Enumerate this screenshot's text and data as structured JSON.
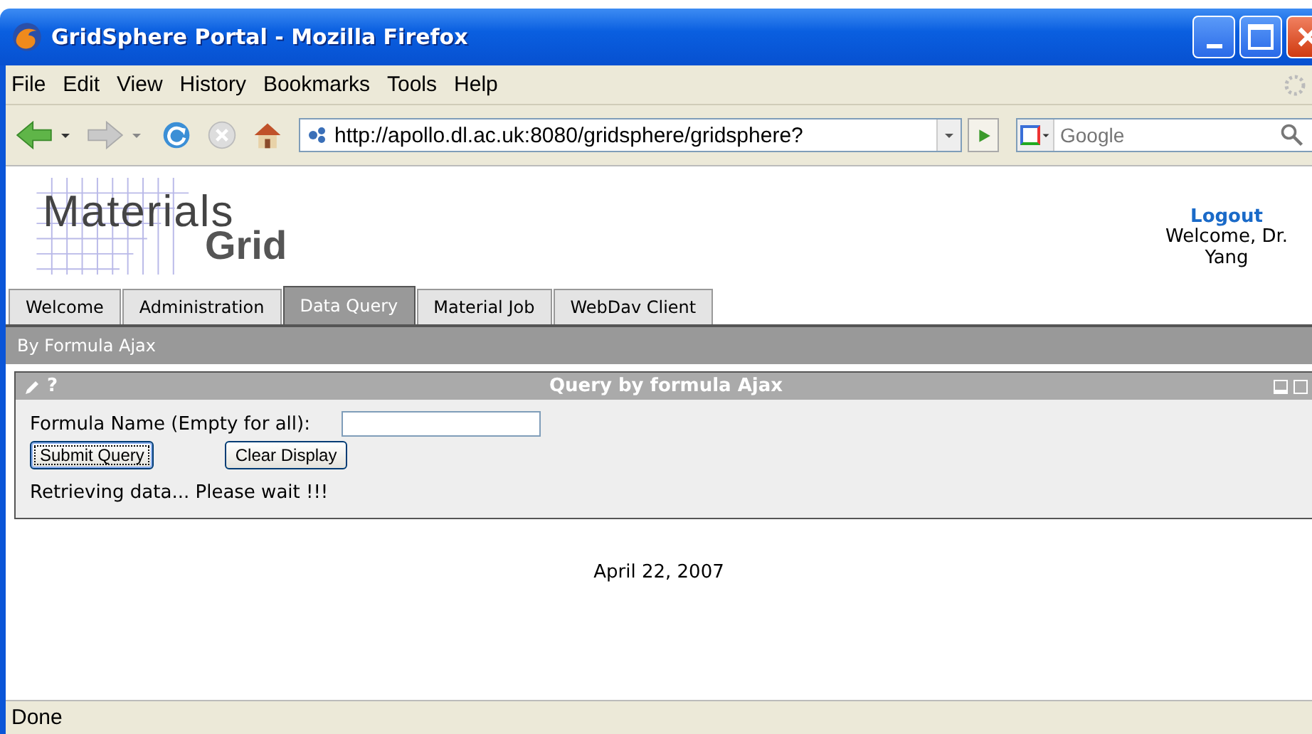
{
  "window": {
    "title": "GridSphere Portal - Mozilla Firefox"
  },
  "menu": [
    "File",
    "Edit",
    "View",
    "History",
    "Bookmarks",
    "Tools",
    "Help"
  ],
  "address_bar": {
    "value": "http://apollo.dl.ac.uk:8080/gridsphere/gridsphere?"
  },
  "search": {
    "placeholder": "Google"
  },
  "header": {
    "logo_top": "Materials",
    "logo_bottom": "Grid",
    "logout": "Logout",
    "welcome": "Welcome, Dr. Yang"
  },
  "tabs": [
    {
      "label": "Welcome",
      "selected": false
    },
    {
      "label": "Administration",
      "selected": false
    },
    {
      "label": "Data Query",
      "selected": true
    },
    {
      "label": "Material Job",
      "selected": false
    },
    {
      "label": "WebDav Client",
      "selected": false
    }
  ],
  "subnav": [
    "By Formula Ajax"
  ],
  "portlet": {
    "title": "Query by formula Ajax",
    "help": "?",
    "field_label": "Formula Name (Empty for all):",
    "buttons": [
      "Submit Query",
      "Clear Display"
    ],
    "message": "Retrieving data... Please wait !!!"
  },
  "footer": "April 22, 2007",
  "status_bar": "Done"
}
